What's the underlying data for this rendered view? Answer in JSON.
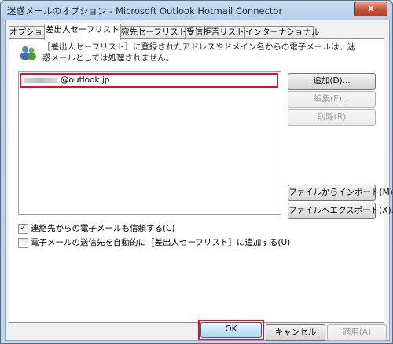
{
  "window": {
    "title": "迷惑メールのオプション - Microsoft Outlook Hotmail Connector",
    "close_label": "x"
  },
  "tabs": [
    {
      "label": "オプション"
    },
    {
      "label": "差出人セーフリスト"
    },
    {
      "label": "宛先セーフリスト"
    },
    {
      "label": "受信拒否リスト"
    },
    {
      "label": "インターナショナル"
    }
  ],
  "panel": {
    "description": "［差出人セーフリスト］に登録されたアドレスやドメイン名からの電子メールは、迷惑メールとしては処理されません。",
    "list_items": [
      {
        "email_suffix": "@outlook.jp"
      }
    ],
    "buttons": {
      "add": "追加(D)...",
      "edit": "編集(E)...",
      "delete": "削除(R)",
      "import": "ファイルからインポート(M)...",
      "export": "ファイルへエクスポート(X)..."
    },
    "checkboxes": [
      {
        "label": "連絡先からの電子メールも信頼する(C)",
        "checked": true
      },
      {
        "label": "電子メールの送信先を自動的に［差出人セーフリスト］に追加する(U)",
        "checked": false
      }
    ]
  },
  "footer": {
    "ok": "OK",
    "cancel": "キャンセル",
    "apply": "適用(A)"
  },
  "colors": {
    "highlight": "#e0112b",
    "title_bar": "#c9dcf1"
  }
}
